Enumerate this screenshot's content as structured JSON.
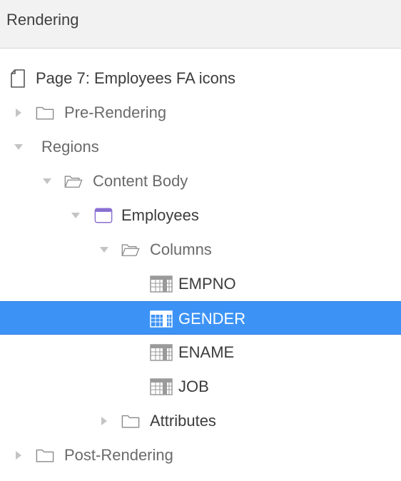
{
  "panel": {
    "title": "Rendering"
  },
  "tree": {
    "items": [
      {
        "label": "Page 7: Employees FA icons",
        "icon": "page-icon",
        "toggle": "none"
      },
      {
        "label": "Pre-Rendering",
        "icon": "folder-icon",
        "toggle": "collapsed"
      },
      {
        "label": "Regions",
        "icon": "none",
        "toggle": "expanded"
      },
      {
        "label": "Content Body",
        "icon": "folder-open-icon",
        "toggle": "expanded"
      },
      {
        "label": "Employees",
        "icon": "region-icon",
        "toggle": "expanded"
      },
      {
        "label": "Columns",
        "icon": "folder-open-icon",
        "toggle": "expanded"
      },
      {
        "label": "EMPNO",
        "icon": "column-icon",
        "toggle": "none"
      },
      {
        "label": "GENDER",
        "icon": "column-icon",
        "toggle": "none",
        "selected": true
      },
      {
        "label": "ENAME",
        "icon": "column-icon",
        "toggle": "none"
      },
      {
        "label": "JOB",
        "icon": "column-icon",
        "toggle": "none"
      },
      {
        "label": "Attributes",
        "icon": "folder-icon",
        "toggle": "collapsed"
      },
      {
        "label": "Post-Rendering",
        "icon": "folder-icon",
        "toggle": "collapsed"
      }
    ]
  },
  "colors": {
    "selection": "#3d93f5",
    "region_accent": "#8a6fd1",
    "header_bg": "#f2f2f2"
  }
}
